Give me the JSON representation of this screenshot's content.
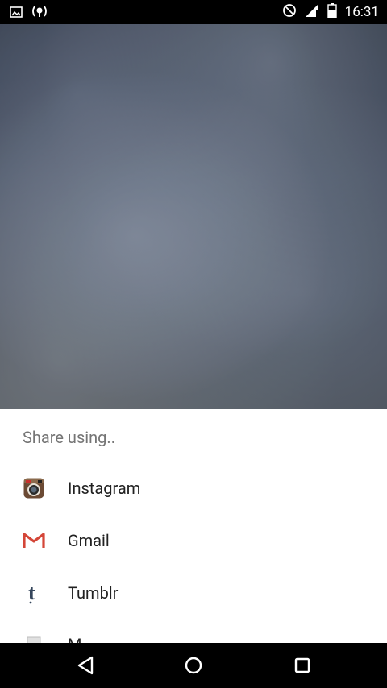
{
  "status_bar": {
    "time": "16:31",
    "icons": [
      "image-icon",
      "hotspot-icon",
      "do-not-disturb-icon",
      "cell-signal-icon",
      "battery-icon"
    ]
  },
  "share_sheet": {
    "title": "Share using..",
    "items": [
      {
        "label": "Instagram",
        "icon": "instagram-icon"
      },
      {
        "label": "Gmail",
        "icon": "gmail-icon"
      },
      {
        "label": "Tumblr",
        "icon": "tumblr-icon"
      },
      {
        "label": "M",
        "icon": "messages-icon"
      }
    ]
  },
  "nav_bar": {
    "buttons": [
      "back-icon",
      "home-icon",
      "recents-icon"
    ]
  }
}
